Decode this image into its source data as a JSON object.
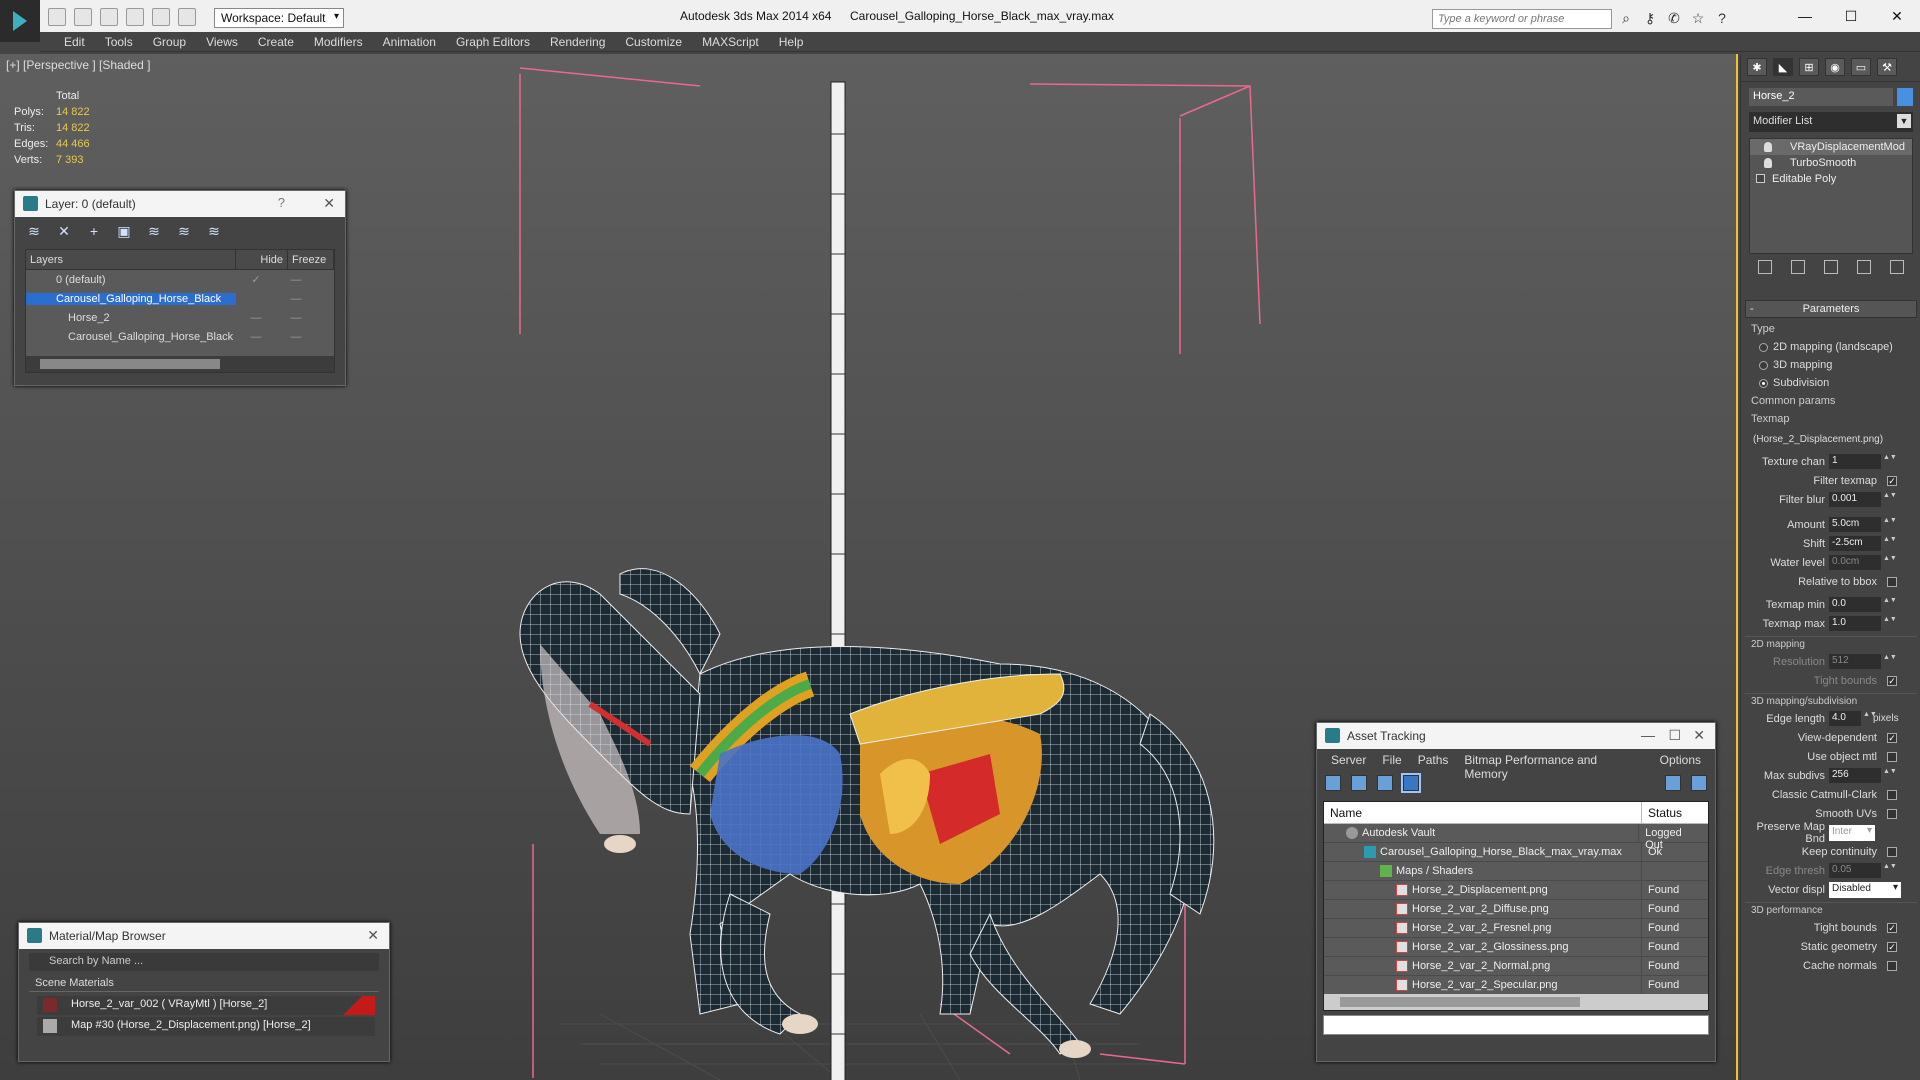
{
  "titlebar": {
    "workspace": "Workspace: Default",
    "app_title": "Autodesk 3ds Max  2014 x64",
    "file_title": "Carousel_Galloping_Horse_Black_max_vray.max",
    "search_placeholder": "Type a keyword or phrase"
  },
  "menu": [
    "Edit",
    "Tools",
    "Group",
    "Views",
    "Create",
    "Modifiers",
    "Animation",
    "Graph Editors",
    "Rendering",
    "Customize",
    "MAXScript",
    "Help"
  ],
  "viewport": {
    "label": "[+] [Perspective ] [Shaded ]",
    "stats": {
      "header": "Total",
      "rows": [
        {
          "label": "Polys:",
          "value": "14 822"
        },
        {
          "label": "Tris:",
          "value": "14 822"
        },
        {
          "label": "Edges:",
          "value": "44 466"
        },
        {
          "label": "Verts:",
          "value": "7 393"
        }
      ]
    }
  },
  "layer_panel": {
    "title": "Layer: 0 (default)",
    "help": "?",
    "columns": {
      "name": "Layers",
      "hide": "Hide",
      "freeze": "Freeze"
    },
    "rows": [
      {
        "name": "0 (default)",
        "hide": "✓",
        "freeze": "—",
        "selected": false
      },
      {
        "name": "Carousel_Galloping_Horse_Black",
        "hide": "",
        "freeze": "—",
        "selected": true
      },
      {
        "name": "Horse_2",
        "hide": "—",
        "freeze": "—",
        "selected": false
      },
      {
        "name": "Carousel_Galloping_Horse_Black",
        "hide": "—",
        "freeze": "—",
        "selected": false
      }
    ]
  },
  "material_browser": {
    "title": "Material/Map Browser",
    "search_placeholder": "Search by Name ...",
    "group": "Scene Materials",
    "items": [
      "Horse_2_var_002 ( VRayMtl ) [Horse_2]",
      "Map #30 (Horse_2_Displacement.png) [Horse_2]"
    ]
  },
  "asset_tracking": {
    "title": "Asset Tracking",
    "menu": [
      "Server",
      "File",
      "Paths",
      "Bitmap Performance and Memory",
      "Options"
    ],
    "columns": {
      "name": "Name",
      "status": "Status"
    },
    "rows": [
      {
        "name": "Autodesk Vault",
        "status": "Logged Out",
        "icon": "vault",
        "indent": 1
      },
      {
        "name": "Carousel_Galloping_Horse_Black_max_vray.max",
        "status": "Ok",
        "icon": "max",
        "indent": 2
      },
      {
        "name": "Maps / Shaders",
        "status": "",
        "icon": "folder",
        "indent": 3
      },
      {
        "name": "Horse_2_Displacement.png",
        "status": "Found",
        "icon": "png",
        "indent": 4
      },
      {
        "name": "Horse_2_var_2_Diffuse.png",
        "status": "Found",
        "icon": "png",
        "indent": 4
      },
      {
        "name": "Horse_2_var_2_Fresnel.png",
        "status": "Found",
        "icon": "png",
        "indent": 4
      },
      {
        "name": "Horse_2_var_2_Glossiness.png",
        "status": "Found",
        "icon": "png",
        "indent": 4
      },
      {
        "name": "Horse_2_var_2_Normal.png",
        "status": "Found",
        "icon": "png",
        "indent": 4
      },
      {
        "name": "Horse_2_var_2_Specular.png",
        "status": "Found",
        "icon": "png",
        "indent": 4
      }
    ]
  },
  "command_panel": {
    "object_name": "Horse_2",
    "object_color": "#4a90e2",
    "modifier_list": "Modifier List",
    "stack": [
      "VRayDisplacementMod",
      "TurboSmooth",
      "Editable Poly"
    ],
    "parameters": {
      "title": "Parameters",
      "type_label": "Type",
      "types": [
        {
          "label": "2D mapping (landscape)",
          "selected": false
        },
        {
          "label": "3D mapping",
          "selected": false
        },
        {
          "label": "Subdivision",
          "selected": true
        }
      ],
      "common_params": "Common params",
      "texmap_label": "Texmap",
      "texmap": "(Horse_2_Displacement.png)",
      "texture_chan": {
        "label": "Texture chan",
        "value": "1"
      },
      "filter_texmap": "Filter texmap",
      "filter_blur": {
        "label": "Filter blur",
        "value": "0.001"
      },
      "amount": {
        "label": "Amount",
        "value": "5.0cm"
      },
      "shift": {
        "label": "Shift",
        "value": "-2.5cm"
      },
      "water_level": {
        "label": "Water level",
        "value": "0.0cm"
      },
      "relative_to_bbox": "Relative to bbox",
      "texmap_min": {
        "label": "Texmap min",
        "value": "0.0"
      },
      "texmap_max": {
        "label": "Texmap max",
        "value": "1.0"
      },
      "mapping2d": "2D mapping",
      "resolution": {
        "label": "Resolution",
        "value": "512"
      },
      "tight_bounds": "Tight bounds",
      "mapping3d": "3D mapping/subdivision",
      "edge_length": {
        "label": "Edge length",
        "value": "4.0",
        "suffix": "pixels"
      },
      "view_dependent": "View-dependent",
      "use_object_mtl": "Use object mtl",
      "max_subdivs": {
        "label": "Max subdivs",
        "value": "256"
      },
      "classic_catmull": "Classic Catmull-Clark",
      "smooth_uvs": "Smooth UVs",
      "preserve_map": {
        "label": "Preserve Map Bnd",
        "value": "Inter"
      },
      "keep_continuity": "Keep continuity",
      "edge_thresh": {
        "label": "Edge thresh",
        "value": "0.05"
      },
      "vector_displ": {
        "label": "Vector displ",
        "value": "Disabled"
      },
      "performance": "3D performance",
      "perf_tight_bounds": "Tight bounds",
      "static_geometry": "Static geometry",
      "cache_normals": "Cache normals"
    }
  }
}
